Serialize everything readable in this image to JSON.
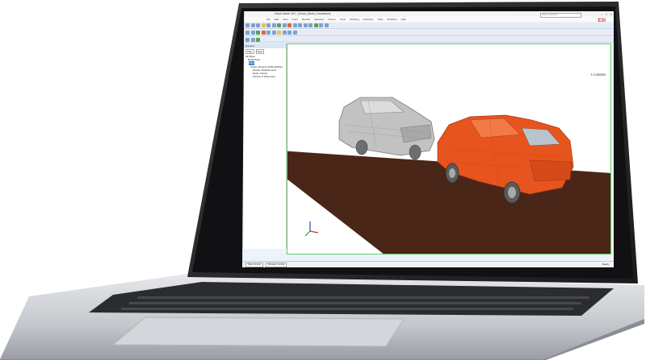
{
  "app": {
    "title": "Visual-Viewer 16.0 - [Crash_Scene_Comparison]",
    "window_buttons": [
      "–",
      "□",
      "×"
    ]
  },
  "menu": [
    "File",
    "Edit",
    "View",
    "Insert",
    "Results",
    "Selection",
    "Curves",
    "Tools",
    "Scripting",
    "Hierarchy",
    "Tools",
    "Windows",
    "Help"
  ],
  "search": {
    "placeholder": "Search Assistant"
  },
  "brand": {
    "logo_text": "ESI"
  },
  "tree": {
    "header": "Explorer",
    "tabs": [
      "Page",
      "Edge"
    ],
    "nodes": [
      "All Pages",
      "Model Page",
      "Page",
      "Impact_Dynamic (PAM-CRASH)",
      "Results: Displacements",
      "Mode: Velocity",
      "Number of Responses"
    ]
  },
  "viewport": {
    "readout": "T: 0.000000"
  },
  "status": {
    "tabs": [
      "Data Console",
      "Message Console"
    ],
    "left_label": "Ready"
  },
  "colors": {
    "ground": "#4a2618",
    "car_red": "#e8541e",
    "car_grey": "#b9b9b9",
    "frame_green": "#5fd06a",
    "laptop_silver": "#c9ccd1",
    "laptop_bezel": "#2a2a2c"
  }
}
